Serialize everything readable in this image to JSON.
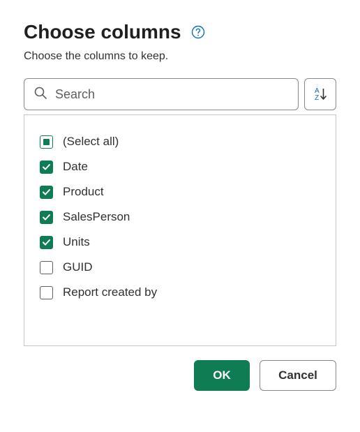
{
  "header": {
    "title": "Choose columns",
    "subtitle": "Choose the columns to keep."
  },
  "search": {
    "placeholder": "Search",
    "value": ""
  },
  "columns": {
    "selectAll": {
      "label": "(Select all)",
      "state": "indeterminate"
    },
    "items": [
      {
        "label": "Date",
        "checked": true
      },
      {
        "label": "Product",
        "checked": true
      },
      {
        "label": "SalesPerson",
        "checked": true
      },
      {
        "label": "Units",
        "checked": true
      },
      {
        "label": "GUID",
        "checked": false
      },
      {
        "label": "Report created by",
        "checked": false
      }
    ]
  },
  "buttons": {
    "ok": "OK",
    "cancel": "Cancel"
  },
  "colors": {
    "accent": "#107c54"
  }
}
